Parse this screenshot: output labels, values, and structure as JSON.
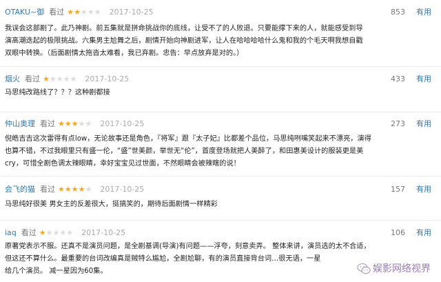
{
  "icons": {
    "star": "★",
    "wm_logo": "wechat-logo-icon"
  },
  "colors": {
    "star_on": "#f5a623",
    "star_off": "#dcdcdc",
    "link": "#3377aa"
  },
  "comments": [
    {
      "user": "OTAKU~御",
      "status": "看过",
      "rating": 2,
      "time": "2017-10-25",
      "votes": "853",
      "useful": "有用",
      "lines": [
        "我误会这部剧了。此乃神剧。前五集就是拼命挑战你的底线，让受不了的人败退。只要能撑下来的人，就能感受到导",
        "演高潮迭起的极限挑战。六集男主尬舞之后，剧情开始向神剧进军，让人在哈哈哈哈什么鬼和我的个毛天啊我想自戳",
        "双眼中转换。（后面剧情太拖沓太难看，我已弃剧。忠告：早点放弃是对的。）"
      ]
    },
    {
      "user": "烟火",
      "status": "看过",
      "rating": 1,
      "time": "2017-10-25",
      "votes": "433",
      "useful": "有用",
      "lines": [
        "马思纯改路线了？？？这种剧都接"
      ]
    },
    {
      "user": "仲山奥理",
      "status": "看过",
      "rating": 3,
      "time": "2017-10-25",
      "votes": "273",
      "useful": "有用",
      "lines": [
        "倪皓吉吉这次雷得有点low，无论故事还是角色，『将军』跟『太子妃』比都差个品位，马思纯咧嘴笑起来不漂亮，演得",
        "也算不错，不过我眼里只有盛一伦，“盛”世美颜，举世无“伦”，首度登场就把人美醉了，和田惠美设计的服装更是美",
        "cry，可惜全剧色调太辣眼睛，幸好宝宝见过世面，不然眼睛会被辣瞎的说！"
      ]
    },
    {
      "user": "会飞的猫",
      "status": "看过",
      "rating": 4,
      "time": "2017-10-25",
      "votes": "157",
      "useful": "有用",
      "lines": [
        "马思纯好很美 男女主的反差很大，挺搞笑的，期待后面剧情一样精彩"
      ]
    },
    {
      "user": "iaq",
      "status": "看过",
      "rating": 1,
      "time": "2017-10-25",
      "votes": "106",
      "useful": "有用",
      "lines": [
        "原著党表示不服。还真不是演员问题，是全剧基调(导演)有问题——浮夸，刻意卖弄。 整体来讲，演员选的太不合适，",
        "但这还不算什么。最重要的台词改编真是贼特么尴尬，全剧尬聊，有的演员直接背台词…很无语，一星",
        "给几个演员。 减一星因为60集。"
      ]
    }
  ],
  "watermark": "娱影网络视界"
}
